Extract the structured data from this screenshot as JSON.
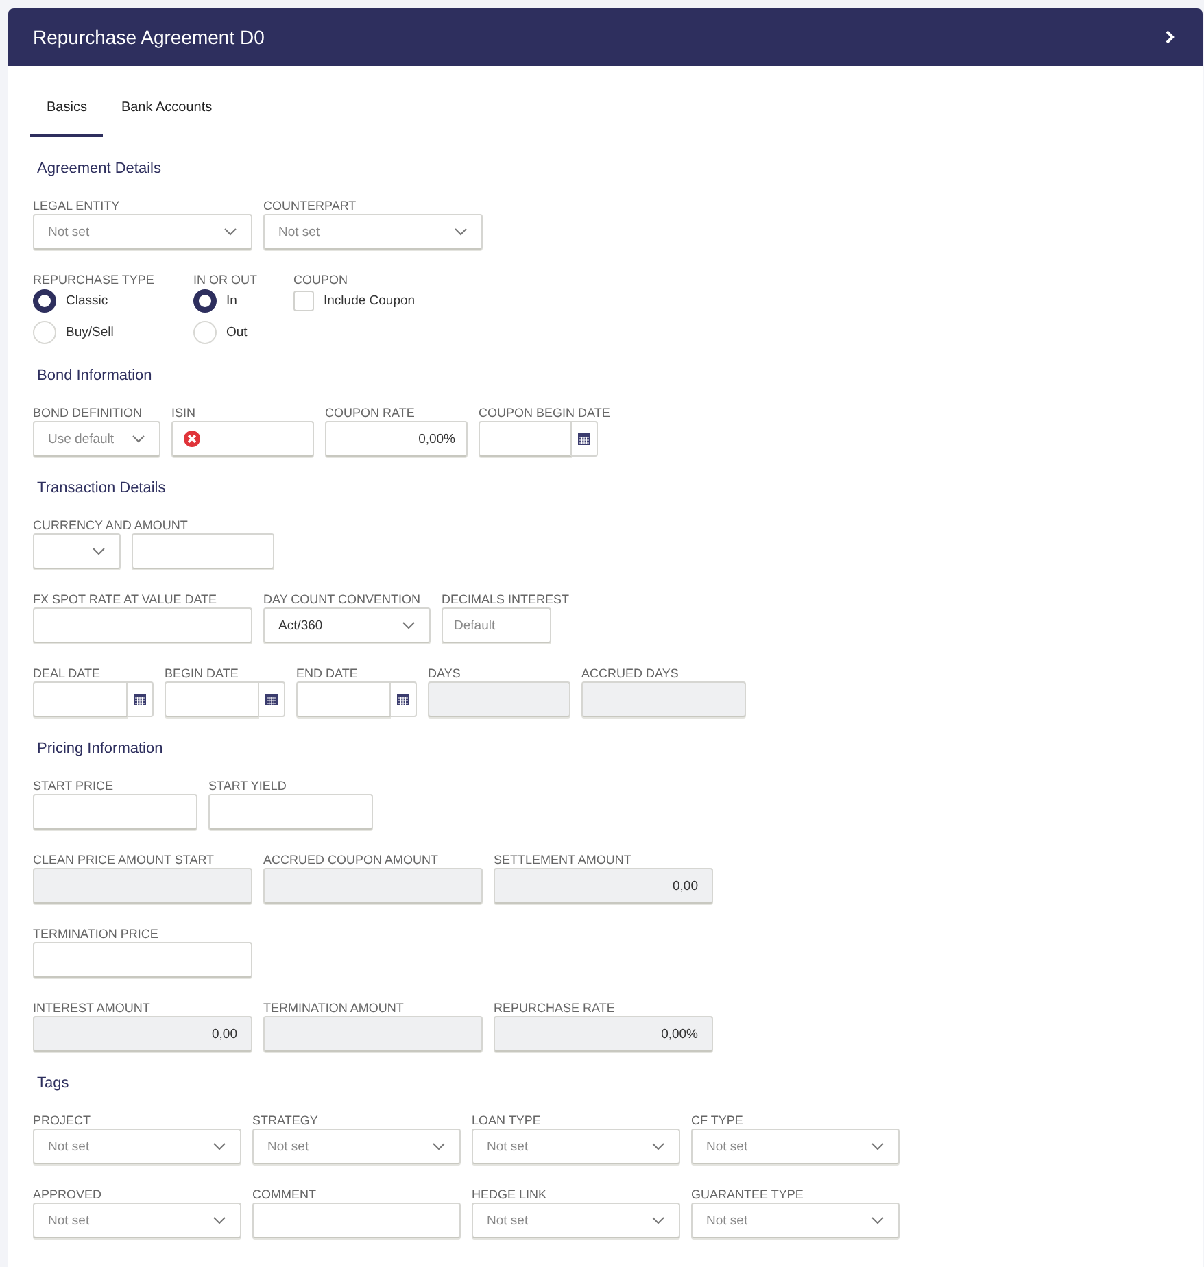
{
  "window": {
    "title": "Repurchase Agreement D0"
  },
  "tabs": [
    {
      "label": "Basics",
      "selected": true
    },
    {
      "label": "Bank Accounts",
      "selected": false
    }
  ],
  "sections": [
    {
      "title": "Agreement Details",
      "rows": [
        {
          "fields": [
            {
              "label": "LEGAL ENTITY",
              "kind": "select",
              "placeholder": "Not set"
            },
            {
              "label": "COUNTERPART",
              "kind": "select",
              "placeholder": "Not set"
            }
          ]
        },
        {
          "fields": [
            {
              "label": "REPURCHASE TYPE",
              "kind": "radio",
              "options": [
                {
                  "label": "Classic",
                  "selected": true
                },
                {
                  "label": "Buy/Sell",
                  "selected": false
                }
              ]
            },
            {
              "label": "IN OR OUT",
              "kind": "radio",
              "options": [
                {
                  "label": "In",
                  "selected": true
                },
                {
                  "label": "Out",
                  "selected": false
                }
              ]
            },
            {
              "label": "COUPON",
              "kind": "checkbox",
              "options": [
                {
                  "label": "Include Coupon",
                  "checked": false
                }
              ]
            }
          ]
        }
      ]
    },
    {
      "title": "Bond Information",
      "rows": [
        {
          "fields": [
            {
              "label": "BOND DEFINITION",
              "kind": "select",
              "placeholder": "Use default"
            },
            {
              "label": "ISIN",
              "kind": "text",
              "error": true
            },
            {
              "label": "COUPON RATE",
              "kind": "text",
              "value": "0,00%"
            },
            {
              "label": "COUPON BEGIN DATE",
              "kind": "date"
            }
          ]
        }
      ]
    },
    {
      "title": "Transaction Details",
      "rows": [
        {
          "fields": [
            {
              "label": "CURRENCY AND AMOUNT",
              "kind": "select"
            },
            {
              "kind": "text"
            }
          ]
        },
        {
          "fields": [
            {
              "label": "FX SPOT RATE AT VALUE DATE",
              "kind": "text"
            },
            {
              "label": "DAY COUNT CONVENTION",
              "kind": "select",
              "value": "Act/360"
            },
            {
              "label": "DECIMALS INTEREST",
              "kind": "text",
              "placeholder": "Default"
            }
          ]
        },
        {
          "fields": [
            {
              "label": "DEAL DATE",
              "kind": "date"
            },
            {
              "label": "BEGIN DATE",
              "kind": "date"
            },
            {
              "label": "END DATE",
              "kind": "date"
            },
            {
              "label": "DAYS",
              "kind": "readonly"
            },
            {
              "label": "ACCRUED DAYS",
              "kind": "readonly"
            }
          ]
        }
      ]
    },
    {
      "title": "Pricing Information",
      "rows": [
        {
          "fields": [
            {
              "label": "START PRICE",
              "kind": "text"
            },
            {
              "label": "START YIELD",
              "kind": "text"
            }
          ]
        },
        {
          "fields": [
            {
              "label": "CLEAN PRICE AMOUNT START",
              "kind": "readonly"
            },
            {
              "label": "ACCRUED COUPON AMOUNT",
              "kind": "readonly"
            },
            {
              "label": "SETTLEMENT AMOUNT",
              "kind": "readonly",
              "value": "0,00"
            }
          ]
        },
        {
          "fields": [
            {
              "label": "TERMINATION PRICE",
              "kind": "text"
            }
          ]
        },
        {
          "fields": [
            {
              "label": "INTEREST AMOUNT",
              "kind": "readonly",
              "value": "0,00"
            },
            {
              "label": "TERMINATION AMOUNT",
              "kind": "readonly"
            },
            {
              "label": "REPURCHASE RATE",
              "kind": "readonly",
              "value": "0,00%"
            }
          ]
        }
      ]
    },
    {
      "title": "Tags",
      "rows": [
        {
          "fields": [
            {
              "label": "PROJECT",
              "kind": "select",
              "placeholder": "Not set"
            },
            {
              "label": "STRATEGY",
              "kind": "select",
              "placeholder": "Not set"
            },
            {
              "label": "LOAN TYPE",
              "kind": "select",
              "placeholder": "Not set"
            },
            {
              "label": "CF TYPE",
              "kind": "select",
              "placeholder": "Not set"
            }
          ]
        },
        {
          "fields": [
            {
              "label": "APPROVED",
              "kind": "select",
              "placeholder": "Not set"
            },
            {
              "label": "COMMENT",
              "kind": "text"
            },
            {
              "label": "HEDGE LINK",
              "kind": "select",
              "placeholder": "Not set"
            },
            {
              "label": "GUARANTEE TYPE",
              "kind": "select",
              "placeholder": "Not set"
            }
          ]
        }
      ]
    }
  ]
}
